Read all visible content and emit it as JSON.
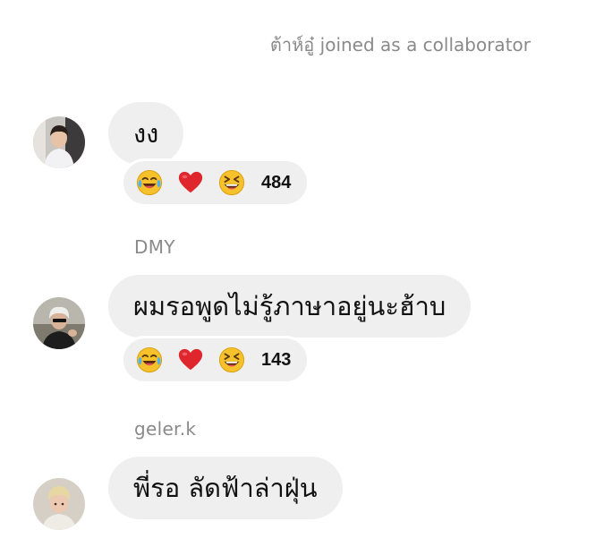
{
  "system_message": "ต้าห์อู๋ joined as a collaborator",
  "comments": [
    {
      "sender": "",
      "text": "งง",
      "reactions": [
        "laughing-tears-emoji",
        "red-heart-emoji",
        "grinning-squinting-emoji"
      ],
      "count": "484"
    },
    {
      "sender": "DMY",
      "text": "ผมรอพูดไม่รู้ภาษาอยู่นะฮ้าบ",
      "reactions": [
        "laughing-tears-emoji",
        "red-heart-emoji",
        "grinning-squinting-emoji"
      ],
      "count": "143"
    },
    {
      "sender": "geler.k",
      "text": "พี่รอ ลัดฟ้าล่าฝุ่น"
    }
  ],
  "colors": {
    "bubble": "#efefef",
    "muted_text": "#8a8a8a",
    "heart": "#e0262d",
    "emoji_face": "#f6c12a"
  }
}
